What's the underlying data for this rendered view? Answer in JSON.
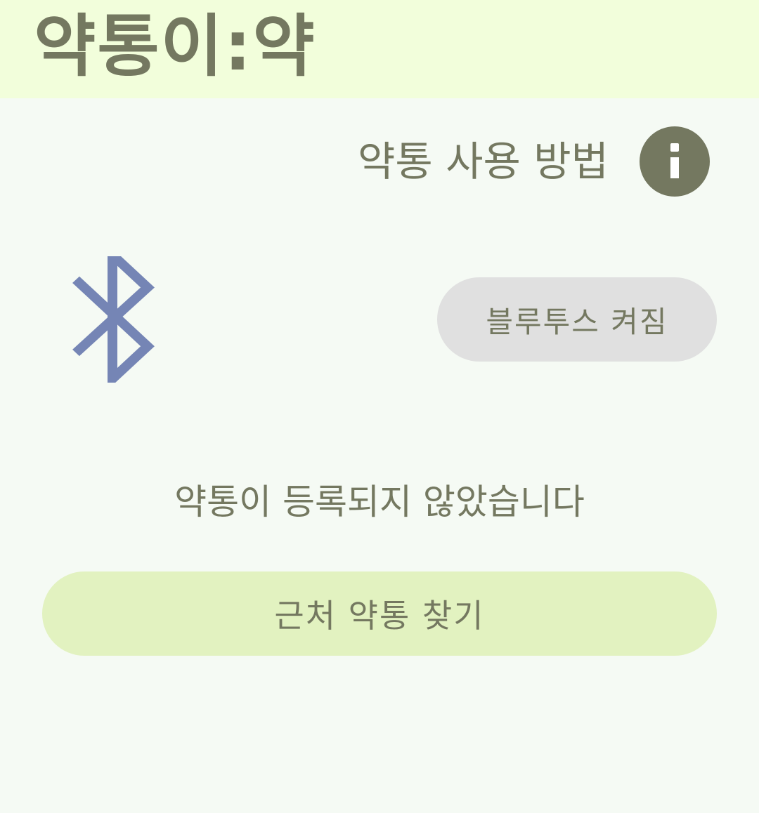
{
  "header": {
    "title": "약통이:약"
  },
  "howto": {
    "label": "약통 사용 방법",
    "icon": "info-icon"
  },
  "bluetooth": {
    "icon": "bluetooth-icon",
    "toggle_label": "블루투스 켜짐"
  },
  "status": {
    "message": "약통이 등록되지 않았습니다"
  },
  "actions": {
    "find_nearby_label": "근처 약통 찾기"
  },
  "colors": {
    "accent": "#747860",
    "header_bg": "#f2fedb",
    "page_bg": "#f5faf4",
    "toggle_bg": "#e0e0e0",
    "primary_button_bg": "#e2f2c0",
    "bluetooth_icon": "#7585b5"
  }
}
